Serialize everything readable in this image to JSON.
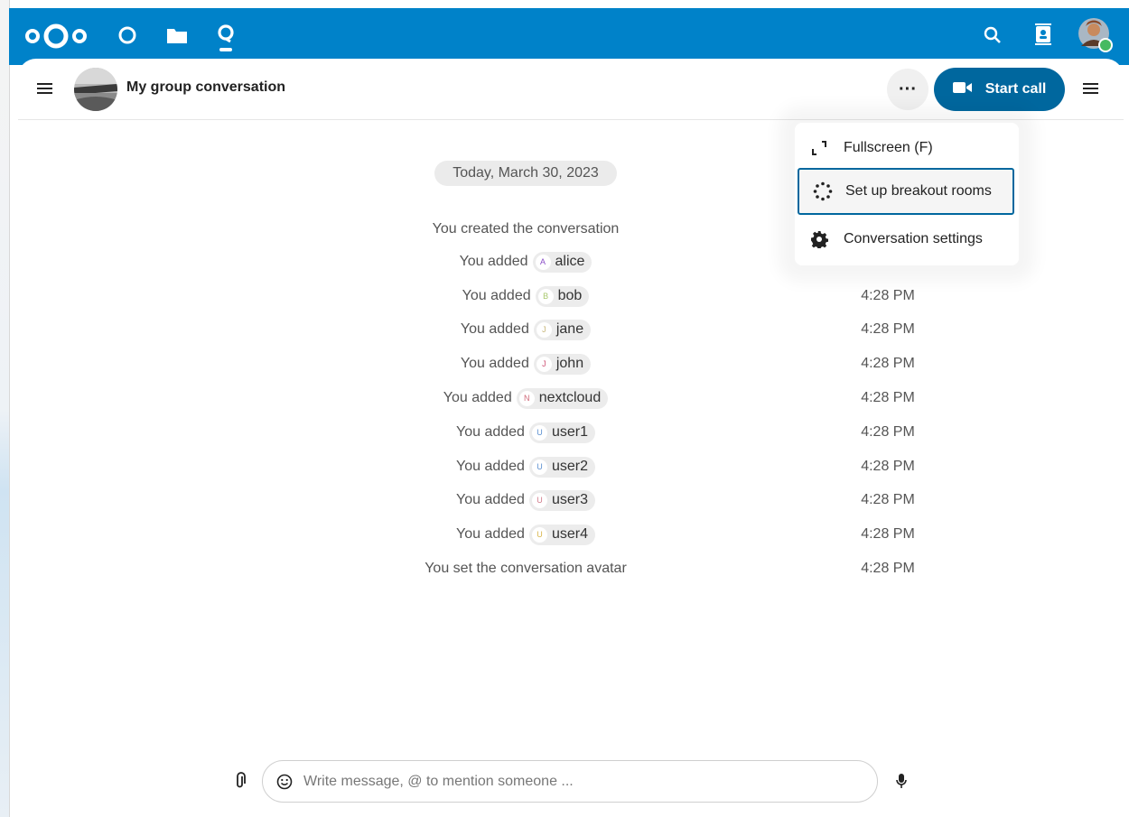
{
  "topbar": {
    "apps": [
      {
        "icon": "nextcloud-logo-icon"
      },
      {
        "icon": "dashboard-circle-icon"
      },
      {
        "icon": "files-folder-icon"
      },
      {
        "icon": "talk-app-icon"
      }
    ],
    "right_icons": [
      "search-icon",
      "contacts-icon",
      "user-avatar"
    ],
    "brand_color": "#0082c9"
  },
  "header": {
    "title": "My group conversation",
    "start_call_label": "Start call",
    "start_call_color": "#00679e"
  },
  "menu": {
    "items": [
      {
        "label": "Fullscreen (F)",
        "icon": "fullscreen-icon"
      },
      {
        "label": "Set up breakout rooms",
        "icon": "breakout-rooms-icon"
      },
      {
        "label": "Conversation settings",
        "icon": "gear-icon"
      }
    ]
  },
  "chat": {
    "date": "Today, March 30, 2023",
    "messages": [
      {
        "text": "You created the conversation",
        "time": ""
      },
      {
        "text": "You added",
        "mention": "alice",
        "initial": "A",
        "color": "#8a4dc7",
        "time": ""
      },
      {
        "text": "You added",
        "mention": "bob",
        "initial": "B",
        "color": "#a9c96e",
        "time": "4:28 PM"
      },
      {
        "text": "You added",
        "mention": "jane",
        "initial": "J",
        "color": "#c9b97e",
        "time": "4:28 PM"
      },
      {
        "text": "You added",
        "mention": "john",
        "initial": "J",
        "color": "#d05a7a",
        "time": "4:28 PM"
      },
      {
        "text": "You added",
        "mention": "nextcloud",
        "initial": "N",
        "color": "#d06a7a",
        "time": "4:28 PM"
      },
      {
        "text": "You added",
        "mention": "user1",
        "initial": "U",
        "color": "#5a8fd0",
        "time": "4:28 PM"
      },
      {
        "text": "You added",
        "mention": "user2",
        "initial": "U",
        "color": "#5a8fd0",
        "time": "4:28 PM"
      },
      {
        "text": "You added",
        "mention": "user3",
        "initial": "U",
        "color": "#d07a8a",
        "time": "4:28 PM"
      },
      {
        "text": "You added",
        "mention": "user4",
        "initial": "U",
        "color": "#d9b64a",
        "time": "4:28 PM"
      },
      {
        "text": "You set the conversation avatar",
        "time": "4:28 PM"
      }
    ]
  },
  "composer": {
    "placeholder": "Write message, @ to mention someone ..."
  }
}
